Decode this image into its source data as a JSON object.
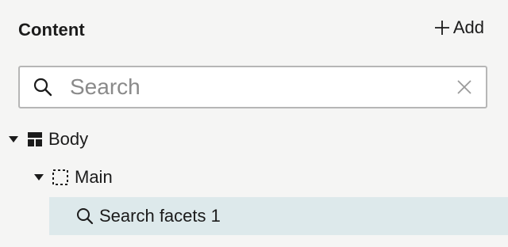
{
  "header": {
    "title": "Content",
    "add_label": "Add"
  },
  "search": {
    "placeholder": "Search",
    "value": ""
  },
  "tree": {
    "items": [
      {
        "label": "Body",
        "icon": "layout-icon",
        "expanded": true
      },
      {
        "label": "Main",
        "icon": "dashed-region-icon",
        "expanded": true
      },
      {
        "label": "Search facets 1",
        "icon": "search-icon",
        "selected": true
      }
    ]
  },
  "colors": {
    "background": "#f5f5f4",
    "selected_row": "#dde9eb",
    "border": "#b6b6b6",
    "placeholder": "#8a8a8a"
  }
}
